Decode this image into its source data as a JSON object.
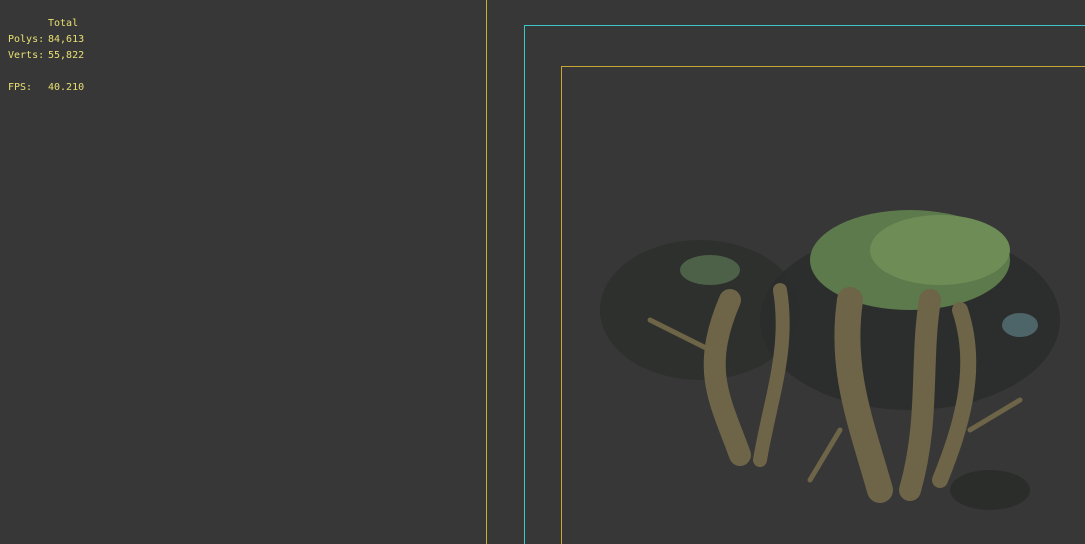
{
  "stats": {
    "header": "Total",
    "polys_label": "Polys:",
    "polys_value": "84,613",
    "verts_label": "Verts:",
    "verts_value": "55,822",
    "fps_label": "FPS:",
    "fps_value": "40.210"
  },
  "colors": {
    "background": "#373737",
    "stats_text": "#e8e070",
    "safe_frame": "#3cc8c8",
    "action_frame": "#c8a830"
  }
}
